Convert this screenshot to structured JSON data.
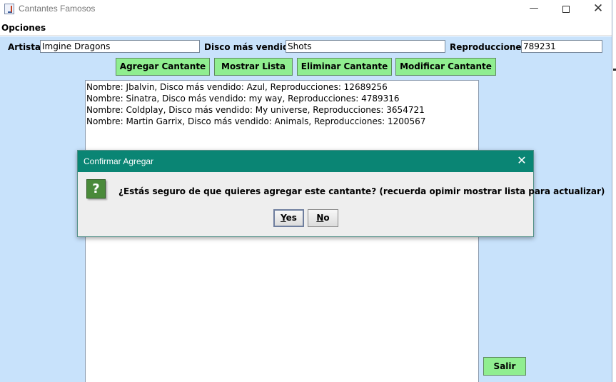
{
  "window": {
    "title": "Cantantes Famosos",
    "minimize_glyph": "—",
    "close_glyph": "✕"
  },
  "menu": {
    "opciones_label": "Opciones"
  },
  "form": {
    "artista_label": "Artista:",
    "artista_value": "Imgine Dragons",
    "disco_label": "Disco más vendido:",
    "disco_value": "Shots",
    "reproducciones_label": "Reproducciones:",
    "reproducciones_value": "789231"
  },
  "buttons": {
    "agregar": "Agregar Cantante",
    "mostrar": "Mostrar Lista",
    "eliminar": "Eliminar Cantante",
    "modificar": "Modificar Cantante",
    "salir": "Salir"
  },
  "list": {
    "lines": [
      "Nombre: Jbalvin, Disco más vendido: Azul, Reproducciones: 12689256",
      "Nombre: Sinatra, Disco más vendido: my way, Reproducciones: 4789316",
      "Nombre: Coldplay, Disco más vendido: My universe, Reproducciones: 3654721",
      "Nombre: Martin Garrix, Disco más vendido: Animals, Reproducciones: 1200567"
    ]
  },
  "dialog": {
    "title": "Confirmar Agregar",
    "close_glyph": "✕",
    "icon_glyph": "?",
    "message": "¿Estás seguro de que quieres agregar este cantante? (recuerda opimir mostrar lista para actualizar)",
    "yes_mnemonic": "Y",
    "yes_rest": "es",
    "no_mnemonic": "N",
    "no_rest": "o"
  },
  "colors": {
    "content_bg": "#c8e2fb",
    "button_green": "#90ee90",
    "dialog_titlebar": "#0a8574",
    "question_icon": "#4a8a3a"
  }
}
